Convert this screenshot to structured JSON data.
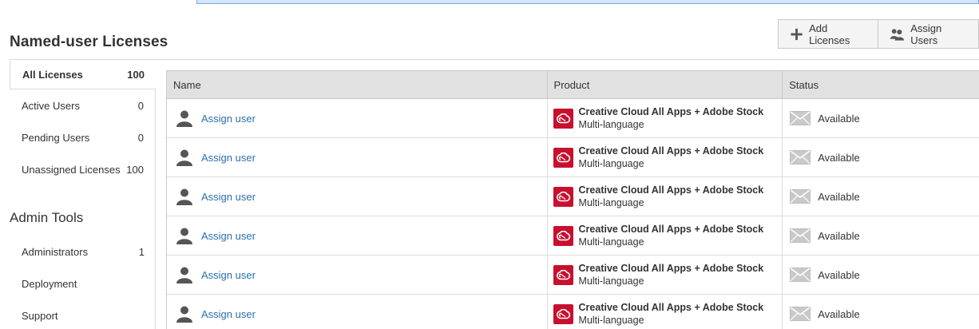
{
  "page": {
    "title": "Named-user Licenses"
  },
  "toolbar": {
    "add_licenses": "Add Licenses",
    "assign_users": "Assign Users"
  },
  "sidebar": {
    "items": [
      {
        "label": "All Licenses",
        "count": "100"
      },
      {
        "label": "Active Users",
        "count": "0"
      },
      {
        "label": "Pending Users",
        "count": "0"
      },
      {
        "label": "Unassigned Licenses",
        "count": "100"
      }
    ],
    "admin_title": "Admin Tools",
    "admin_items": [
      {
        "label": "Administrators",
        "count": "1"
      },
      {
        "label": "Deployment",
        "count": ""
      },
      {
        "label": "Support",
        "count": ""
      }
    ]
  },
  "table": {
    "headers": {
      "name": "Name",
      "product": "Product",
      "status": "Status"
    },
    "rows": [
      {
        "name": "Assign user",
        "product": "Creative Cloud All Apps + Adobe Stock",
        "language": "Multi-language",
        "status": "Available"
      },
      {
        "name": "Assign user",
        "product": "Creative Cloud All Apps + Adobe Stock",
        "language": "Multi-language",
        "status": "Available"
      },
      {
        "name": "Assign user",
        "product": "Creative Cloud All Apps + Adobe Stock",
        "language": "Multi-language",
        "status": "Available"
      },
      {
        "name": "Assign user",
        "product": "Creative Cloud All Apps + Adobe Stock",
        "language": "Multi-language",
        "status": "Available"
      },
      {
        "name": "Assign user",
        "product": "Creative Cloud All Apps + Adobe Stock",
        "language": "Multi-language",
        "status": "Available"
      },
      {
        "name": "Assign user",
        "product": "Creative Cloud All Apps + Adobe Stock",
        "language": "Multi-language",
        "status": "Available"
      }
    ]
  },
  "icons": {
    "user": "user-silhouette-icon",
    "product": "creative-cloud-icon",
    "status": "envelope-icon",
    "add": "plus-icon",
    "assign": "users-icon"
  },
  "colors": {
    "link": "#2a6fb0",
    "product_icon": "#c8102e",
    "header_bg": "#e1e1e1",
    "top_strip": "#d3e6fa"
  }
}
